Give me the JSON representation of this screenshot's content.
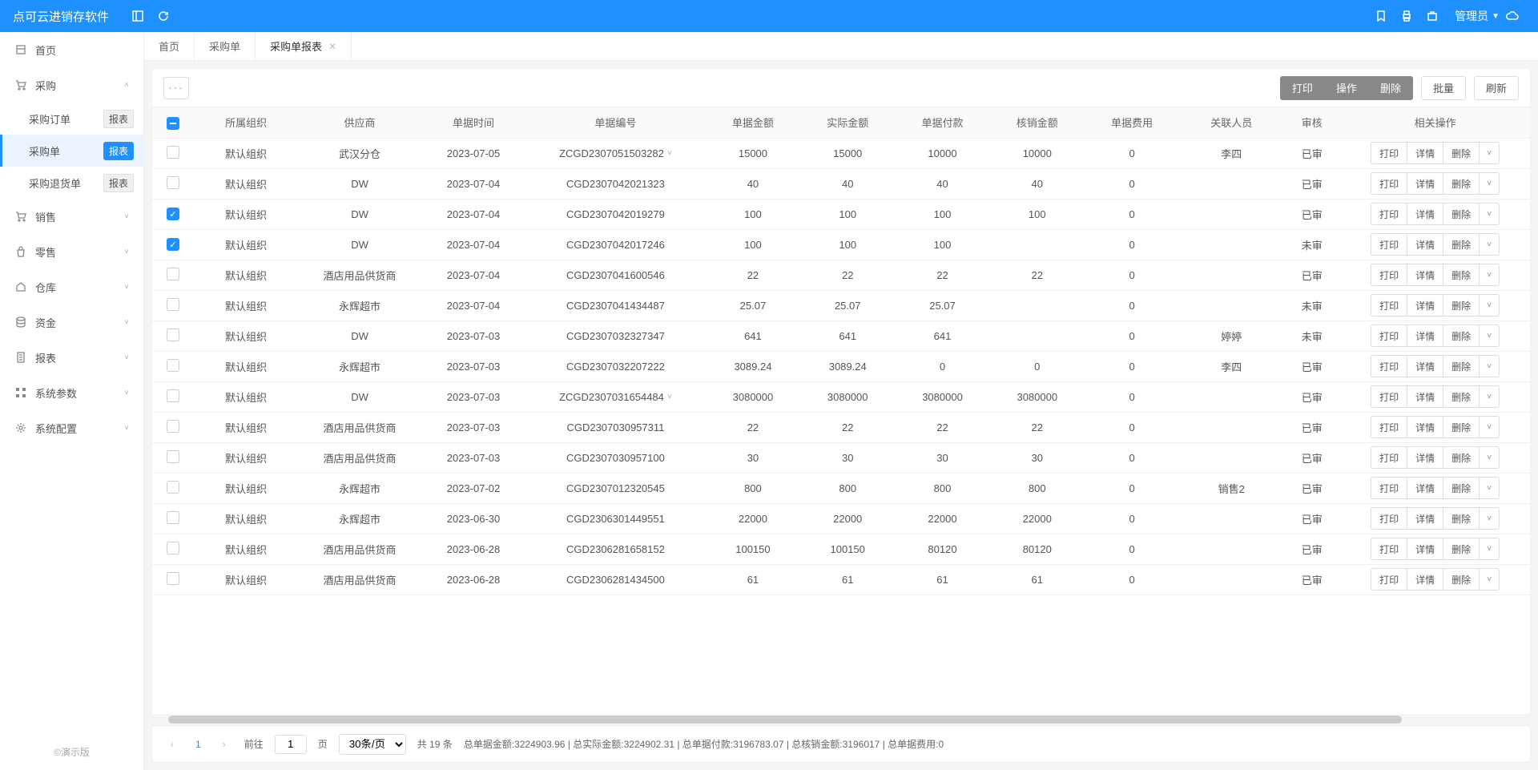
{
  "header": {
    "title": "点可云进销存软件",
    "user": "管理员"
  },
  "sidebar": {
    "items": [
      {
        "icon": "home",
        "label": "首页",
        "expandable": false
      },
      {
        "icon": "cart",
        "label": "采购",
        "expandable": true,
        "expanded": true,
        "subs": [
          {
            "label": "采购订单",
            "badge": "报表",
            "active": false
          },
          {
            "label": "采购单",
            "badge": "报表",
            "active": true
          },
          {
            "label": "采购退货单",
            "badge": "报表",
            "active": false
          }
        ]
      },
      {
        "icon": "cart",
        "label": "销售",
        "expandable": true
      },
      {
        "icon": "bag",
        "label": "零售",
        "expandable": true
      },
      {
        "icon": "house",
        "label": "仓库",
        "expandable": true
      },
      {
        "icon": "db",
        "label": "资金",
        "expandable": true
      },
      {
        "icon": "doc",
        "label": "报表",
        "expandable": true
      },
      {
        "icon": "grid",
        "label": "系统参数",
        "expandable": true
      },
      {
        "icon": "gear",
        "label": "系统配置",
        "expandable": true
      }
    ],
    "footer": "©演示版"
  },
  "tabs": [
    {
      "label": "首页",
      "closable": false,
      "active": false
    },
    {
      "label": "采购单",
      "closable": false,
      "active": false
    },
    {
      "label": "采购单报表",
      "closable": true,
      "active": true
    }
  ],
  "toolbar": {
    "print": "打印",
    "action": "操作",
    "delete": "删除",
    "batch": "批量",
    "refresh": "刷新"
  },
  "columns": [
    "所属组织",
    "供应商",
    "单据时间",
    "单据编号",
    "单据金额",
    "实际金额",
    "单据付款",
    "核销金额",
    "单据费用",
    "关联人员",
    "审核",
    "相关操作"
  ],
  "ops": {
    "print": "打印",
    "detail": "详情",
    "delete": "删除"
  },
  "rows": [
    {
      "checked": false,
      "org": "默认组织",
      "supplier": "武汉分仓",
      "date": "2023-07-05",
      "doc": "ZCGD2307051503282",
      "caret": true,
      "amt": "15000",
      "real": "15000",
      "pay": "10000",
      "wo": "10000",
      "fee": "0",
      "person": "李四",
      "audit": "已审"
    },
    {
      "checked": false,
      "org": "默认组织",
      "supplier": "DW",
      "date": "2023-07-04",
      "doc": "CGD2307042021323",
      "amt": "40",
      "real": "40",
      "pay": "40",
      "wo": "40",
      "fee": "0",
      "person": "",
      "audit": "已审"
    },
    {
      "checked": true,
      "org": "默认组织",
      "supplier": "DW",
      "date": "2023-07-04",
      "doc": "CGD2307042019279",
      "amt": "100",
      "real": "100",
      "pay": "100",
      "wo": "100",
      "fee": "0",
      "person": "",
      "audit": "已审"
    },
    {
      "checked": true,
      "org": "默认组织",
      "supplier": "DW",
      "date": "2023-07-04",
      "doc": "CGD2307042017246",
      "amt": "100",
      "real": "100",
      "pay": "100",
      "wo": "",
      "fee": "0",
      "person": "",
      "audit": "未审"
    },
    {
      "checked": false,
      "org": "默认组织",
      "supplier": "酒店用品供货商",
      "date": "2023-07-04",
      "doc": "CGD2307041600546",
      "amt": "22",
      "real": "22",
      "pay": "22",
      "wo": "22",
      "fee": "0",
      "person": "",
      "audit": "已审"
    },
    {
      "checked": false,
      "org": "默认组织",
      "supplier": "永辉超市",
      "date": "2023-07-04",
      "doc": "CGD2307041434487",
      "amt": "25.07",
      "real": "25.07",
      "pay": "25.07",
      "wo": "",
      "fee": "0",
      "person": "",
      "audit": "未审"
    },
    {
      "checked": false,
      "org": "默认组织",
      "supplier": "DW",
      "date": "2023-07-03",
      "doc": "CGD2307032327347",
      "amt": "641",
      "real": "641",
      "pay": "641",
      "wo": "",
      "fee": "0",
      "person": "婷婷",
      "audit": "未审"
    },
    {
      "checked": false,
      "org": "默认组织",
      "supplier": "永辉超市",
      "date": "2023-07-03",
      "doc": "CGD2307032207222",
      "amt": "3089.24",
      "real": "3089.24",
      "pay": "0",
      "wo": "0",
      "fee": "0",
      "person": "李四",
      "audit": "已审"
    },
    {
      "checked": false,
      "org": "默认组织",
      "supplier": "DW",
      "date": "2023-07-03",
      "doc": "ZCGD2307031654484",
      "caret": true,
      "amt": "3080000",
      "real": "3080000",
      "pay": "3080000",
      "wo": "3080000",
      "fee": "0",
      "person": "",
      "audit": "已审"
    },
    {
      "checked": false,
      "org": "默认组织",
      "supplier": "酒店用品供货商",
      "date": "2023-07-03",
      "doc": "CGD2307030957311",
      "amt": "22",
      "real": "22",
      "pay": "22",
      "wo": "22",
      "fee": "0",
      "person": "",
      "audit": "已审"
    },
    {
      "checked": false,
      "org": "默认组织",
      "supplier": "酒店用品供货商",
      "date": "2023-07-03",
      "doc": "CGD2307030957100",
      "amt": "30",
      "real": "30",
      "pay": "30",
      "wo": "30",
      "fee": "0",
      "person": "",
      "audit": "已审"
    },
    {
      "checked": false,
      "org": "默认组织",
      "supplier": "永辉超市",
      "date": "2023-07-02",
      "doc": "CGD2307012320545",
      "amt": "800",
      "real": "800",
      "pay": "800",
      "wo": "800",
      "fee": "0",
      "person": "销售2",
      "audit": "已审"
    },
    {
      "checked": false,
      "org": "默认组织",
      "supplier": "永辉超市",
      "date": "2023-06-30",
      "doc": "CGD2306301449551",
      "amt": "22000",
      "real": "22000",
      "pay": "22000",
      "wo": "22000",
      "fee": "0",
      "person": "",
      "audit": "已审"
    },
    {
      "checked": false,
      "org": "默认组织",
      "supplier": "酒店用品供货商",
      "date": "2023-06-28",
      "doc": "CGD2306281658152",
      "amt": "100150",
      "real": "100150",
      "pay": "80120",
      "wo": "80120",
      "fee": "0",
      "person": "",
      "audit": "已审"
    },
    {
      "checked": false,
      "org": "默认组织",
      "supplier": "酒店用品供货商",
      "date": "2023-06-28",
      "doc": "CGD2306281434500",
      "amt": "61",
      "real": "61",
      "pay": "61",
      "wo": "61",
      "fee": "0",
      "person": "",
      "audit": "已审"
    }
  ],
  "pager": {
    "page": "1",
    "goto_prefix": "前往",
    "goto_value": "1",
    "goto_suffix": "页",
    "per_page": "30条/页",
    "total": "共 19 条",
    "summary": "总单据金额:3224903.96 | 总实际金额:3224902.31 | 总单据付款:3196783.07 | 总核销金额:3196017 | 总单据费用:0"
  }
}
